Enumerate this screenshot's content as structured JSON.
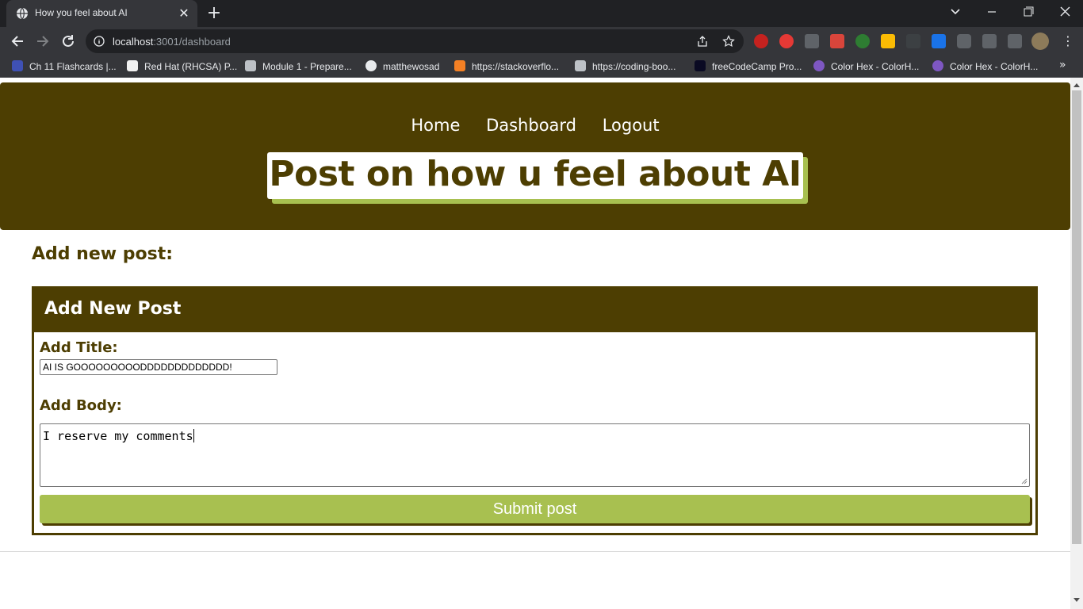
{
  "browser": {
    "tab_title": "How you feel about AI",
    "url_host": "localhost",
    "url_rest": ":3001/dashboard",
    "bookmarks": [
      "Ch 11 Flashcards |...",
      "Red Hat (RHCSA) P...",
      "Module 1 - Prepare...",
      "matthewosad",
      "https://stackoverflo...",
      "https://coding-boo...",
      "freeCodeCamp Pro...",
      "Color Hex - ColorH...",
      "Color Hex - ColorH..."
    ]
  },
  "nav": {
    "home": "Home",
    "dashboard": "Dashboard",
    "logout": "Logout"
  },
  "hero_title": "Post on how u feel about AI",
  "section_heading": "Add new post:",
  "form": {
    "header": "Add New Post",
    "title_label": "Add Title:",
    "title_value": "AI IS GOOOOOOOOODDDDDDDDDDDDD!",
    "body_label": "Add Body:",
    "body_value": "I reserve my comments",
    "submit_label": "Submit post"
  },
  "colors": {
    "brand_dark": "#4d3e02",
    "accent_green": "#a8c050"
  }
}
